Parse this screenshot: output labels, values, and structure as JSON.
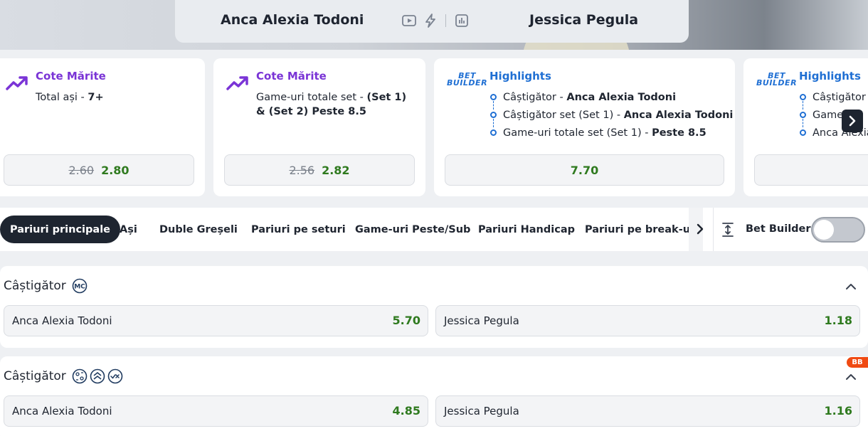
{
  "header": {
    "team_a": "Anca Alexia Todoni",
    "team_b": "Jessica Pegula",
    "icons": [
      "play-video-icon",
      "lightning-icon",
      "stats-chart-icon"
    ]
  },
  "promos": [
    {
      "type": "Cote Mărite",
      "text_pre": "Total ași - ",
      "text_bold": "7+",
      "old_odds": "2.60",
      "new_odds": "2.80"
    },
    {
      "type": "Cote Mărite",
      "text_pre": "Game-uri totale set - ",
      "text_bold": "(Set 1) & (Set 2) Peste 8.5",
      "old_odds": "2.56",
      "new_odds": "2.82"
    },
    {
      "type": "Highlights",
      "logo_top": "BET",
      "logo_bottom": "BUILDER",
      "items": [
        {
          "pre": "Câștigător - ",
          "bold": "Anca Alexia Todoni"
        },
        {
          "pre": "Câștigător set (Set 1) - ",
          "bold": "Anca Alexia Todoni"
        },
        {
          "pre": "Game-uri totale set (Set 1) - ",
          "bold": "Peste 8.5"
        }
      ],
      "odds": "7.70"
    },
    {
      "type": "Highlights",
      "logo_top": "BET",
      "logo_bottom": "BUILDER",
      "items": [
        {
          "pre": "Câștigător s",
          "bold": ""
        },
        {
          "pre": "Game",
          "bold": ""
        },
        {
          "pre": "Anca Alexia",
          "bold": ""
        }
      ]
    }
  ],
  "tabs": [
    "Pariuri principale",
    "Ași",
    "Duble Greșeli",
    "Pariuri pe seturi",
    "Game-uri Peste/Sub",
    "Pariuri Handicap",
    "Pariuri pe break-uri"
  ],
  "bet_builder": {
    "label": "Bet Builder",
    "enabled": false
  },
  "markets": [
    {
      "title": "Câștigător",
      "badge": "MC",
      "selections": [
        {
          "name": "Anca Alexia Todoni",
          "odds": "5.70"
        },
        {
          "name": "Jessica Pegula",
          "odds": "1.18"
        }
      ]
    },
    {
      "title": "Câștigător",
      "corner_badge": "BB",
      "selections": [
        {
          "name": "Anca Alexia Todoni",
          "odds": "4.85"
        },
        {
          "name": "Jessica Pegula",
          "odds": "1.16"
        }
      ]
    }
  ]
}
